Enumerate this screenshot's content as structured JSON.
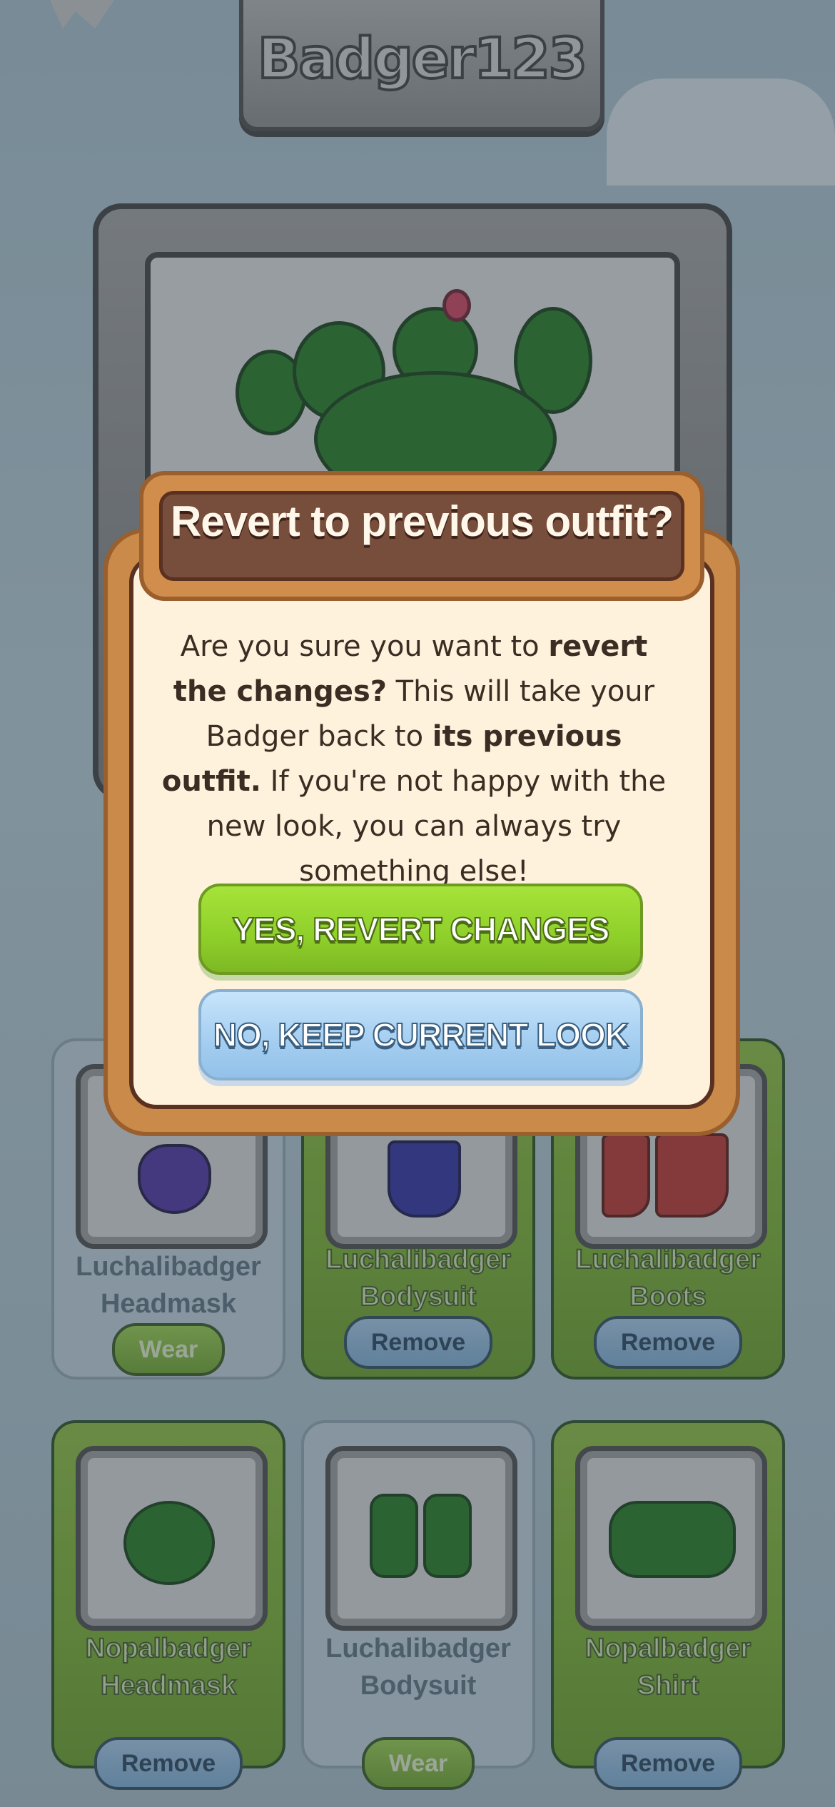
{
  "profile": {
    "username": "Badger123"
  },
  "items": [
    {
      "name_line1": "Luchalibadger",
      "name_line2": "Headmask",
      "action": "Wear",
      "state": "available"
    },
    {
      "name_line1": "Luchalibadger",
      "name_line2": "Bodysuit",
      "action": "Remove",
      "state": "equipped"
    },
    {
      "name_line1": "Luchalibadger",
      "name_line2": "Boots",
      "action": "Remove",
      "state": "equipped"
    },
    {
      "name_line1": "Nopalbadger",
      "name_line2": "Headmask",
      "action": "Remove",
      "state": "equipped"
    },
    {
      "name_line1": "Luchalibadger",
      "name_line2": "Bodysuit",
      "action": "Wear",
      "state": "available"
    },
    {
      "name_line1": "Nopalbadger",
      "name_line2": "Shirt",
      "action": "Remove",
      "state": "equipped"
    }
  ],
  "dialog": {
    "title": "Revert to previous outfit?",
    "body_part1": "Are you sure you want to ",
    "body_bold1": "revert the changes?",
    "body_part2": " This will take your Badger back to ",
    "body_bold2": "its previous outfit.",
    "body_part3": " If you're not happy with the new look, you can always try something else!",
    "confirm_label": "YES, REVERT CHANGES",
    "cancel_label": "NO, KEEP CURRENT LOOK"
  },
  "colors": {
    "equipped_card": "#7ab32a",
    "available_card": "#c4d5e0",
    "confirm_button": "#8fcf2a",
    "cancel_button": "#a3cdf0",
    "dialog_header": "#774d3b"
  }
}
